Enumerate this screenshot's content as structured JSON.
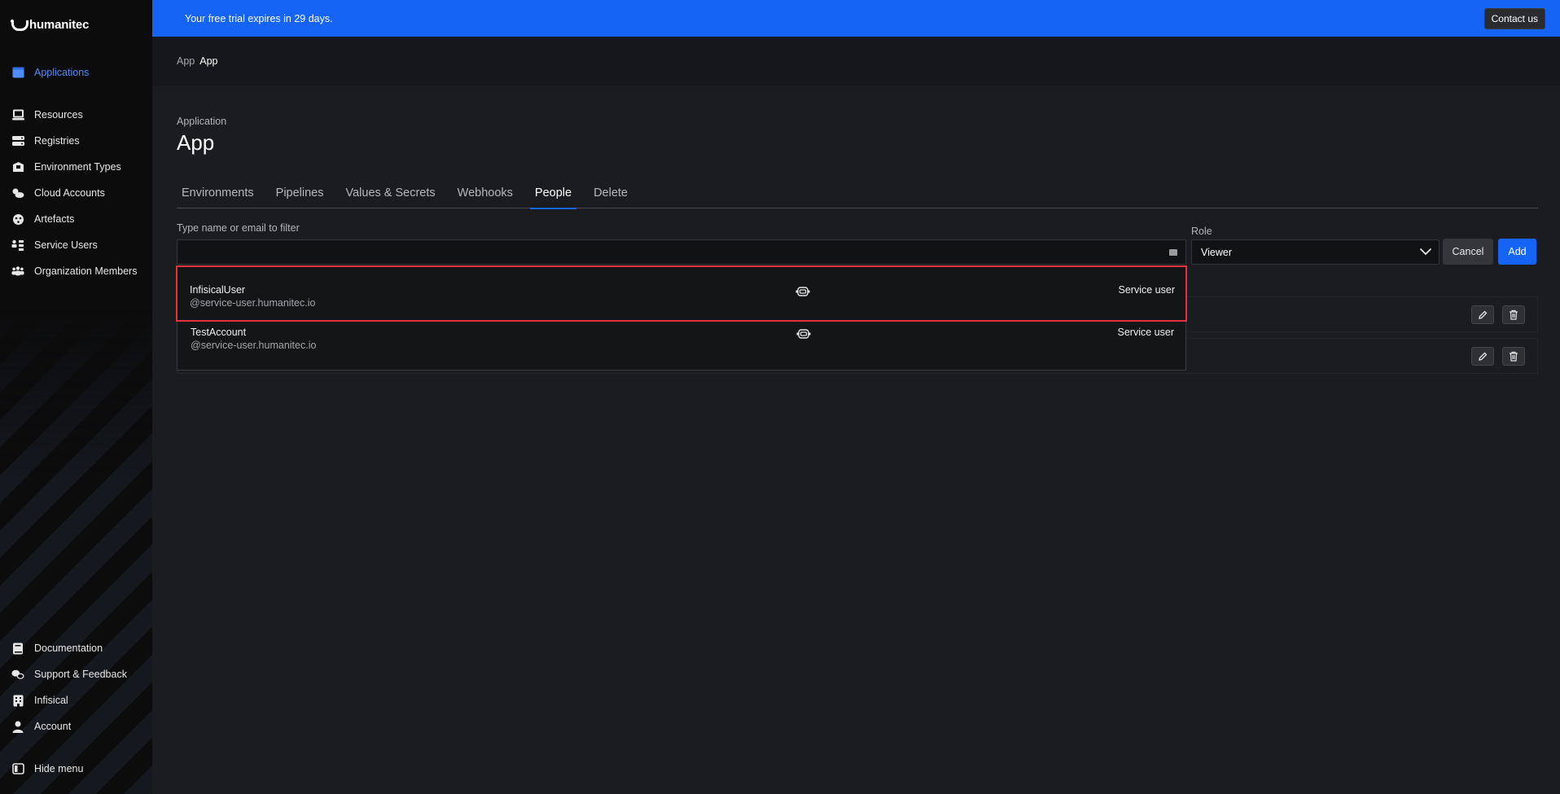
{
  "brand": {
    "name": "humanitec"
  },
  "sidebar": {
    "items": [
      {
        "label": "Applications",
        "icon": "applications-icon",
        "active": true
      },
      {
        "label": "Resources",
        "icon": "resources-icon"
      },
      {
        "label": "Registries",
        "icon": "registries-icon"
      },
      {
        "label": "Environment Types",
        "icon": "environment-types-icon"
      },
      {
        "label": "Cloud Accounts",
        "icon": "cloud-accounts-icon"
      },
      {
        "label": "Artefacts",
        "icon": "artefacts-icon"
      },
      {
        "label": "Service Users",
        "icon": "service-users-icon"
      },
      {
        "label": "Organization Members",
        "icon": "organization-members-icon"
      }
    ],
    "bottom_items": [
      {
        "label": "Documentation",
        "icon": "documentation-icon"
      },
      {
        "label": "Support & Feedback",
        "icon": "support-feedback-icon"
      },
      {
        "label": "Infisical",
        "icon": "organization-icon"
      },
      {
        "label": "Account",
        "icon": "account-icon"
      }
    ],
    "hide_menu": "Hide menu"
  },
  "banner": {
    "message": "Your free trial expires in 29 days.",
    "contact_label": "Contact us",
    "color": "#1664f5"
  },
  "breadcrumb": {
    "parent": "App",
    "current": "App"
  },
  "page": {
    "subtitle": "Application",
    "title": "App",
    "tabs": [
      {
        "label": "Environments"
      },
      {
        "label": "Pipelines"
      },
      {
        "label": "Values & Secrets"
      },
      {
        "label": "Webhooks"
      },
      {
        "label": "People",
        "active": true
      },
      {
        "label": "Delete"
      }
    ]
  },
  "filter": {
    "label": "Type name or email to filter",
    "value": "",
    "placeholder": ""
  },
  "role": {
    "label": "Role",
    "selected": "Viewer"
  },
  "buttons": {
    "cancel": "Cancel",
    "add": "Add"
  },
  "dropdown": {
    "items": [
      {
        "name": "InfisicalUser",
        "email": "@service-user.humanitec.io",
        "type": "Service user",
        "icon": "robot-icon",
        "highlighted": true
      },
      {
        "name": "TestAccount",
        "email": "@service-user.humanitec.io",
        "type": "Service user",
        "icon": "robot-icon"
      }
    ]
  }
}
